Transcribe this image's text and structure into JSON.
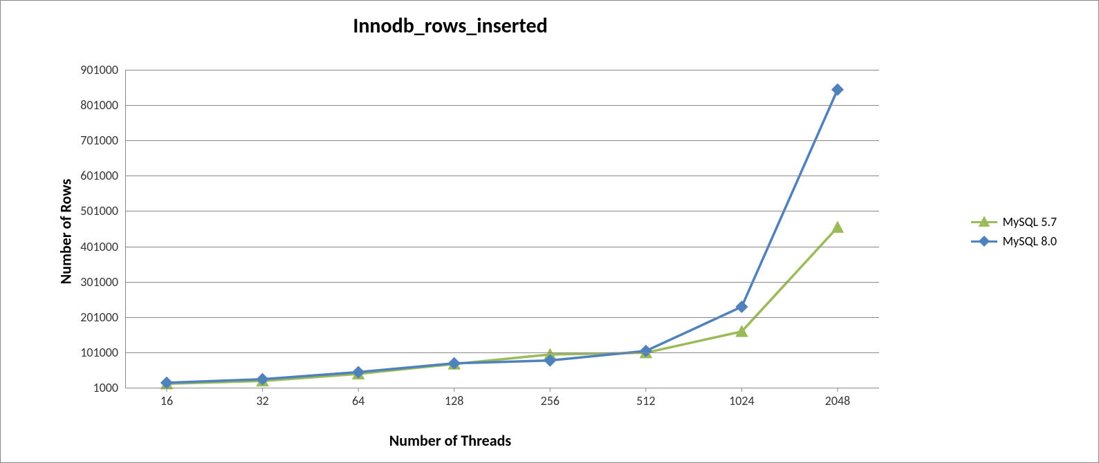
{
  "chart_data": {
    "type": "line",
    "title": "Innodb_rows_inserted",
    "xlabel": "Number of Threads",
    "ylabel": "Number of Rows",
    "categories": [
      "16",
      "32",
      "64",
      "128",
      "256",
      "512",
      "1024",
      "2048"
    ],
    "y_ticks": [
      1000,
      101000,
      201000,
      301000,
      401000,
      501000,
      601000,
      701000,
      801000,
      901000
    ],
    "ylim": [
      1000,
      901000
    ],
    "series": [
      {
        "name": "MySQL 5.7",
        "color": "#9BBB59",
        "marker": "triangle",
        "values": [
          12000,
          20000,
          40000,
          68000,
          95000,
          100000,
          160000,
          455000
        ]
      },
      {
        "name": "MySQL 8.0",
        "color": "#4F81BD",
        "marker": "diamond",
        "values": [
          15000,
          25000,
          45000,
          70000,
          78000,
          105000,
          230000,
          845000
        ]
      }
    ]
  }
}
